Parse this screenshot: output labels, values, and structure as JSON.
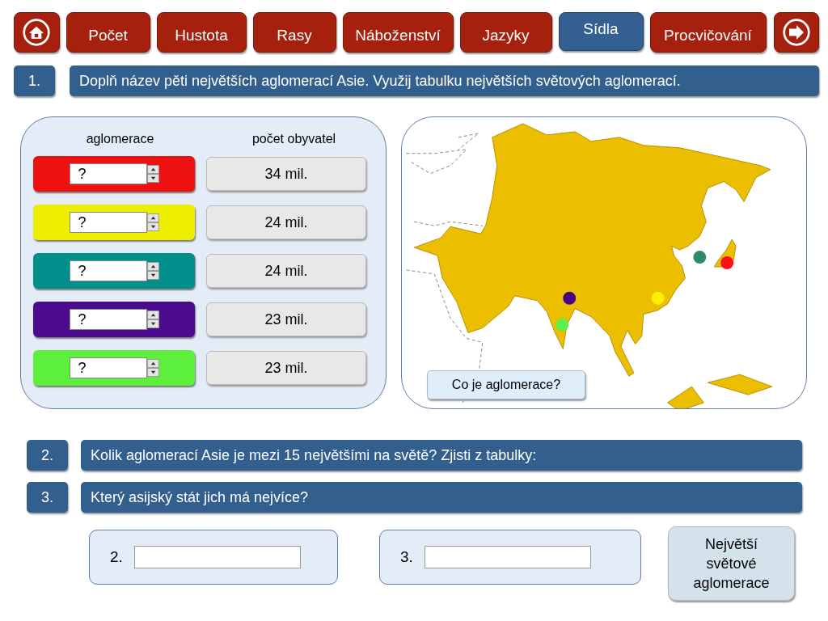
{
  "tabs": [
    {
      "label": "Počet",
      "selected": false
    },
    {
      "label": "Hustota",
      "selected": false
    },
    {
      "label": "Rasy",
      "selected": false
    },
    {
      "label": "Náboženství",
      "selected": false
    },
    {
      "label": "Jazyky",
      "selected": false
    },
    {
      "label": "Sídla",
      "selected": true
    },
    {
      "label": "Procvičování",
      "selected": false
    }
  ],
  "task": {
    "number": "1.",
    "text": "Doplň název pěti největších aglomerací Asie. Využij tabulku největších světových aglomerací."
  },
  "table": {
    "headers": [
      "aglomerace",
      "počet obyvatel"
    ],
    "rows": [
      {
        "color": "#ee1111",
        "value": "?",
        "population": "34 mil."
      },
      {
        "color": "#eeee00",
        "value": "?",
        "population": "24 mil."
      },
      {
        "color": "#008f8a",
        "value": "?",
        "population": "24 mil."
      },
      {
        "color": "#4c0a8c",
        "value": "?",
        "population": "23 mil."
      },
      {
        "color": "#5cf03c",
        "value": "?",
        "population": "23 mil."
      }
    ]
  },
  "map": {
    "markers": [
      {
        "color": "#ff1010"
      },
      {
        "color": "#ffee00"
      },
      {
        "color": "#2e8b6a"
      },
      {
        "color": "#4b0082"
      },
      {
        "color": "#5ef04a"
      }
    ],
    "button": "Co je aglomerace?"
  },
  "questions": [
    {
      "number": "2.",
      "text": "Kolik aglomerací Asie je mezi 15 největšími na světě? Zjisti z tabulky:"
    },
    {
      "number": "3.",
      "text": "Který asijský stát jich má nejvíce?"
    }
  ],
  "answers": [
    {
      "label": "2."
    },
    {
      "label": "3."
    }
  ],
  "table_button": "Největší světové aglomerace"
}
